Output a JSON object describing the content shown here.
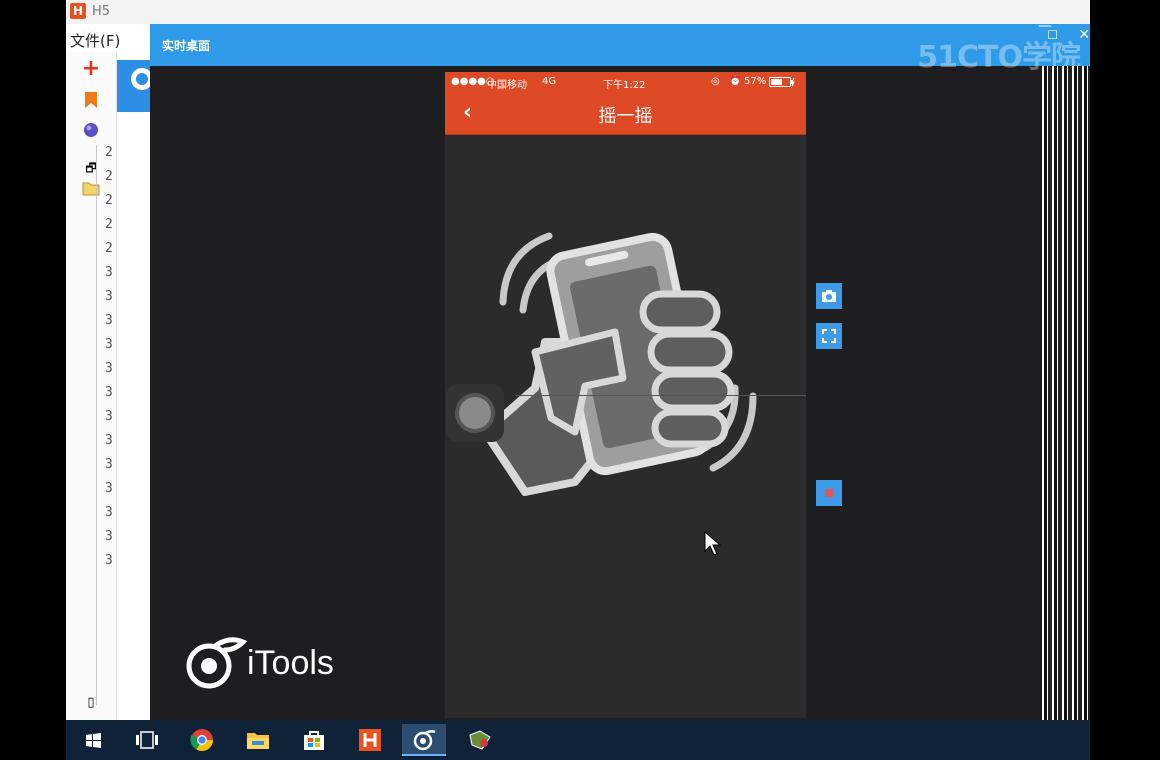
{
  "background_app": {
    "title": "H5",
    "menu_item": "文件(F)",
    "gutter_numbers": [
      "2",
      "2",
      "2",
      "2",
      "2",
      "3",
      "3",
      "3",
      "3",
      "3",
      "3",
      "3",
      "3",
      "3",
      "3",
      "3",
      "3",
      "3"
    ]
  },
  "window": {
    "title": "实时桌面",
    "watermark": "51CTO学院",
    "minimize_glyph": "—",
    "maximize_glyph": "☐",
    "close_glyph": "✕"
  },
  "phone": {
    "status": {
      "signal": "●●●●○",
      "carrier": "中国移动",
      "network": "4G",
      "time": "下午1:22",
      "battery": "57%"
    },
    "navbar": {
      "back_glyph": "‹",
      "title": "摇一摇"
    }
  },
  "sidebar_tools": [
    {
      "name": "screenshot-button",
      "icon": "camera-icon"
    },
    {
      "name": "fullscreen-button",
      "icon": "expand-icon"
    },
    {
      "name": "record-button",
      "icon": "record-icon"
    }
  ],
  "brand": {
    "name": "iTools"
  },
  "taskbar": {
    "items": [
      "start-icon",
      "task-view-icon",
      "chrome-icon",
      "file-explorer-icon",
      "store-icon",
      "hbuilder-icon",
      "itools-icon",
      "app-icon"
    ]
  },
  "colors": {
    "accent_blue": "#2f9ae7",
    "nav_red": "#df4a26",
    "taskbar": "#0f2237"
  }
}
